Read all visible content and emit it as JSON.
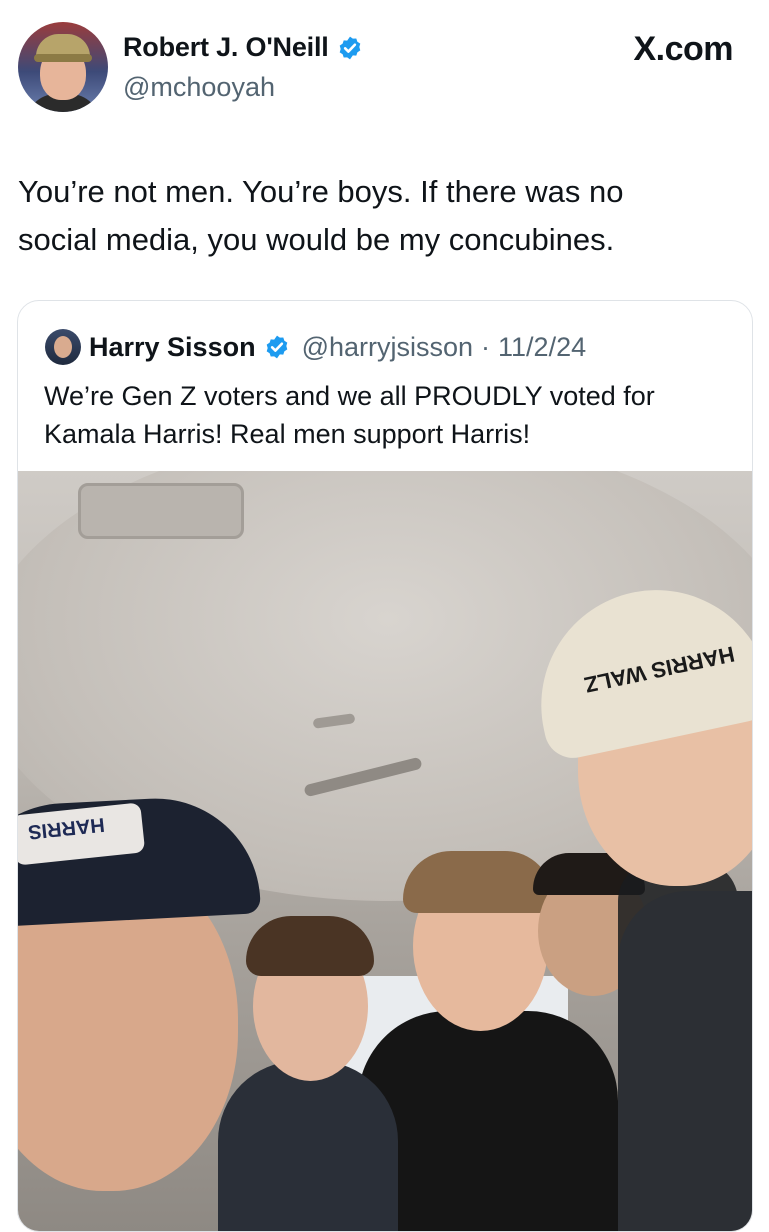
{
  "author": {
    "display_name": "Robert J. O'Neill",
    "handle": "@mchooyah",
    "verified": true
  },
  "brand": "X.com",
  "tweet_text": "You’re not men. You’re boys. If there was no\nsocial media, you would be my concubines.",
  "quoted": {
    "display_name": "Harry Sisson",
    "verified": true,
    "handle": "@harryjsisson",
    "separator": "·",
    "date": "11/2/24",
    "text": "We’re Gen Z voters and we all PROUDLY voted for\nKamala Harris! Real men support Harris!",
    "photo_cap_text_1": "HARRIS WALZ",
    "photo_cap_text_2": "HARRIS"
  },
  "colors": {
    "verified_blue": "#1d9bf0",
    "secondary_text": "#536471",
    "primary_text": "#0f1419"
  }
}
